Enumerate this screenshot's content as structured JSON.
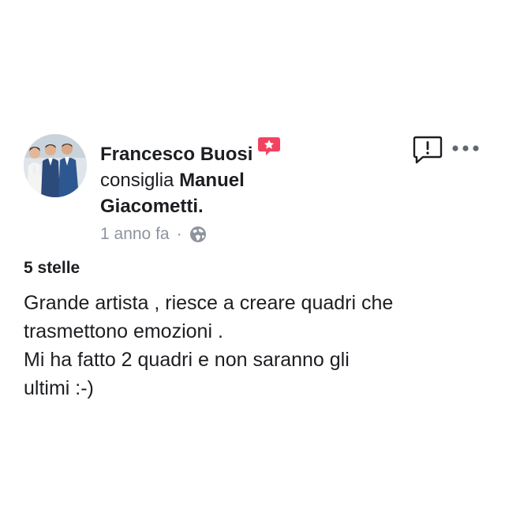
{
  "post": {
    "author": "Francesco Buosi",
    "action": "consiglia",
    "target": "Manuel Giacometti.",
    "target_line1": "Manuel",
    "target_line2": "Giacometti.",
    "timestamp": "1 anno fa",
    "separator": "·",
    "privacy_icon": "globe-icon",
    "badge_icon": "recommendation-star-icon",
    "badge_color": "#f3425f"
  },
  "actions": {
    "report_icon": "report-icon",
    "more_icon": "more-options-icon"
  },
  "review": {
    "rating": "5 stelle",
    "lines": [
      "Grande artista , riesce a creare quadri che",
      "trasmettono emozioni .",
      "Mi ha fatto 2 quadri e non saranno gli",
      "ultimi :-)"
    ]
  }
}
